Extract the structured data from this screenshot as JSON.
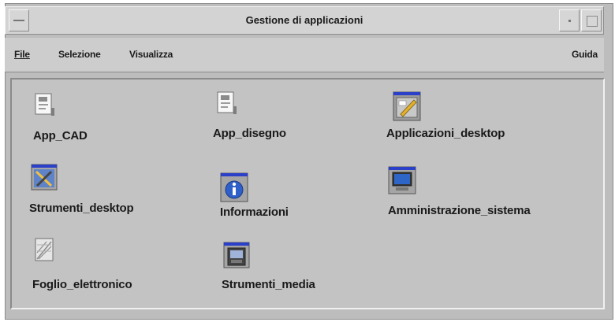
{
  "window": {
    "title": "Gestione di applicazioni"
  },
  "menubar": {
    "file": "File",
    "selezione": "Selezione",
    "visualizza": "Visualizza",
    "guida": "Guida"
  },
  "items": [
    {
      "label": "App_CAD",
      "icon": "document-icon"
    },
    {
      "label": "App_disegno",
      "icon": "document-icon"
    },
    {
      "label": "Applicazioni_desktop",
      "icon": "desktop-apps-icon"
    },
    {
      "label": "Strumenti_desktop",
      "icon": "tools-icon"
    },
    {
      "label": "Informazioni",
      "icon": "info-icon"
    },
    {
      "label": "Amministrazione_sistema",
      "icon": "system-admin-icon"
    },
    {
      "label": "Foglio_elettronico",
      "icon": "spreadsheet-icon"
    },
    {
      "label": "Strumenti_media",
      "icon": "media-tools-icon"
    }
  ]
}
